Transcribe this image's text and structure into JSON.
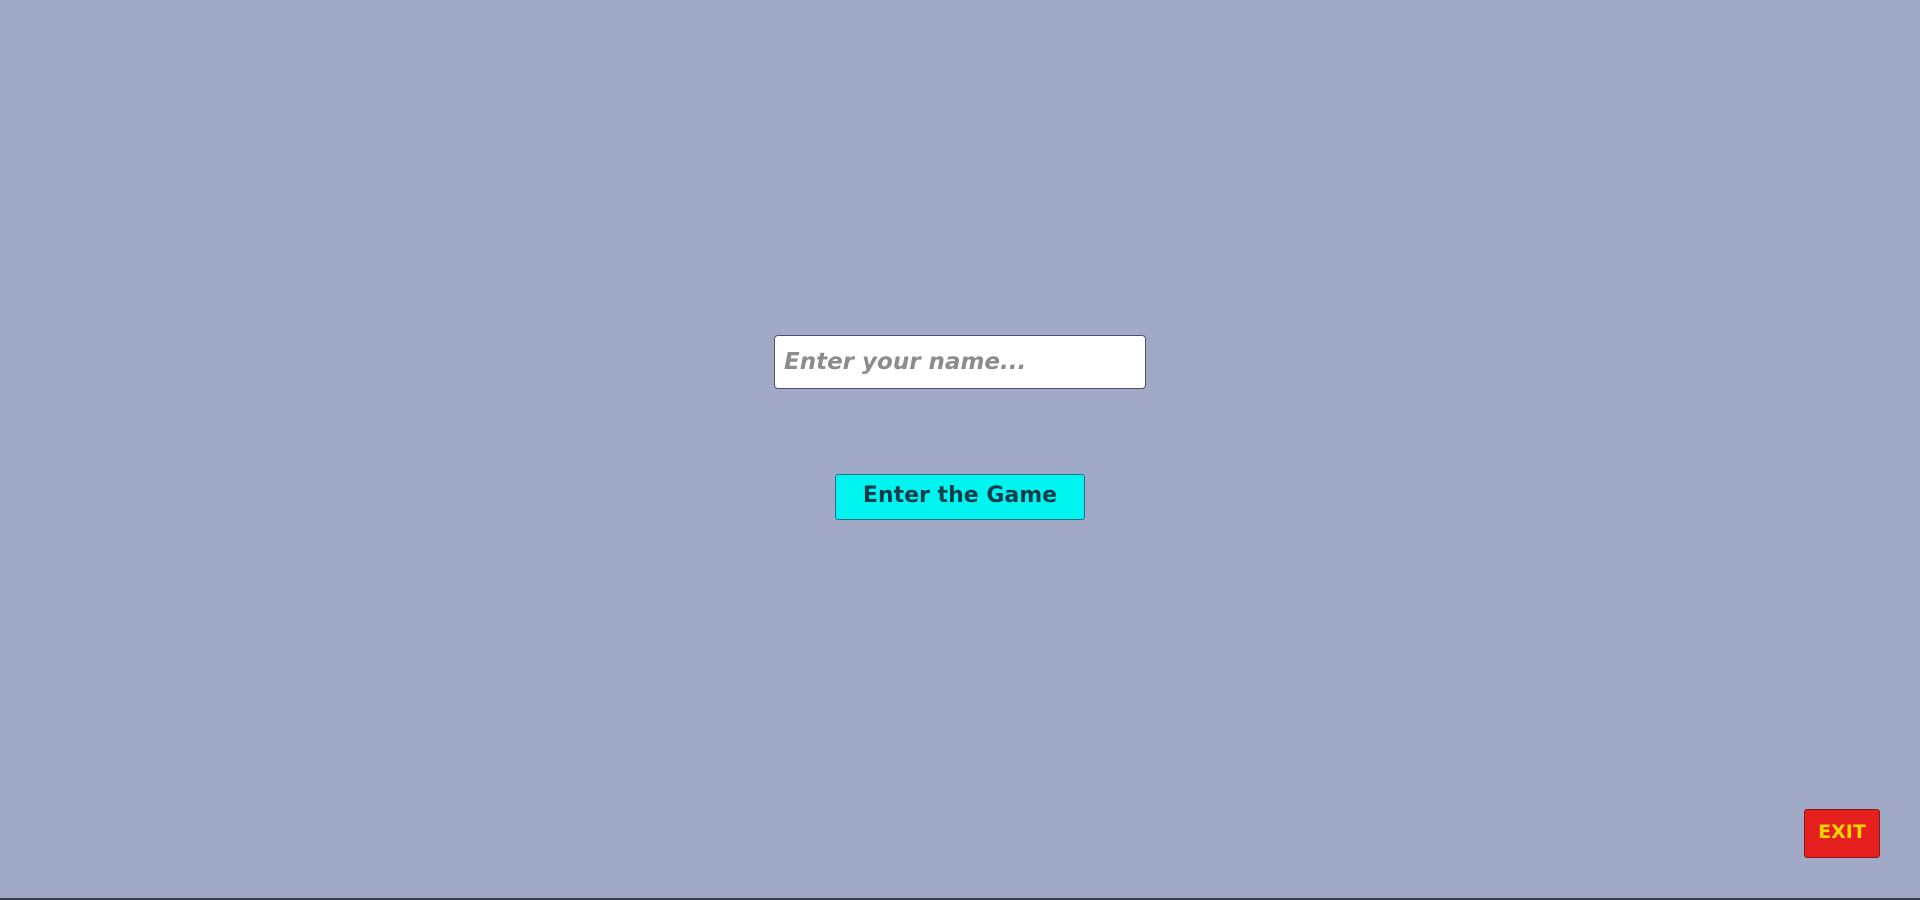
{
  "login": {
    "name_placeholder": "Enter your name...",
    "name_value": "",
    "enter_button_label": "Enter the Game"
  },
  "exit_button_label": "EXIT",
  "colors": {
    "background": "#a0aac6",
    "enter_button": "#00f5f0",
    "exit_button": "#e6201e",
    "exit_text": "#ffd400"
  }
}
